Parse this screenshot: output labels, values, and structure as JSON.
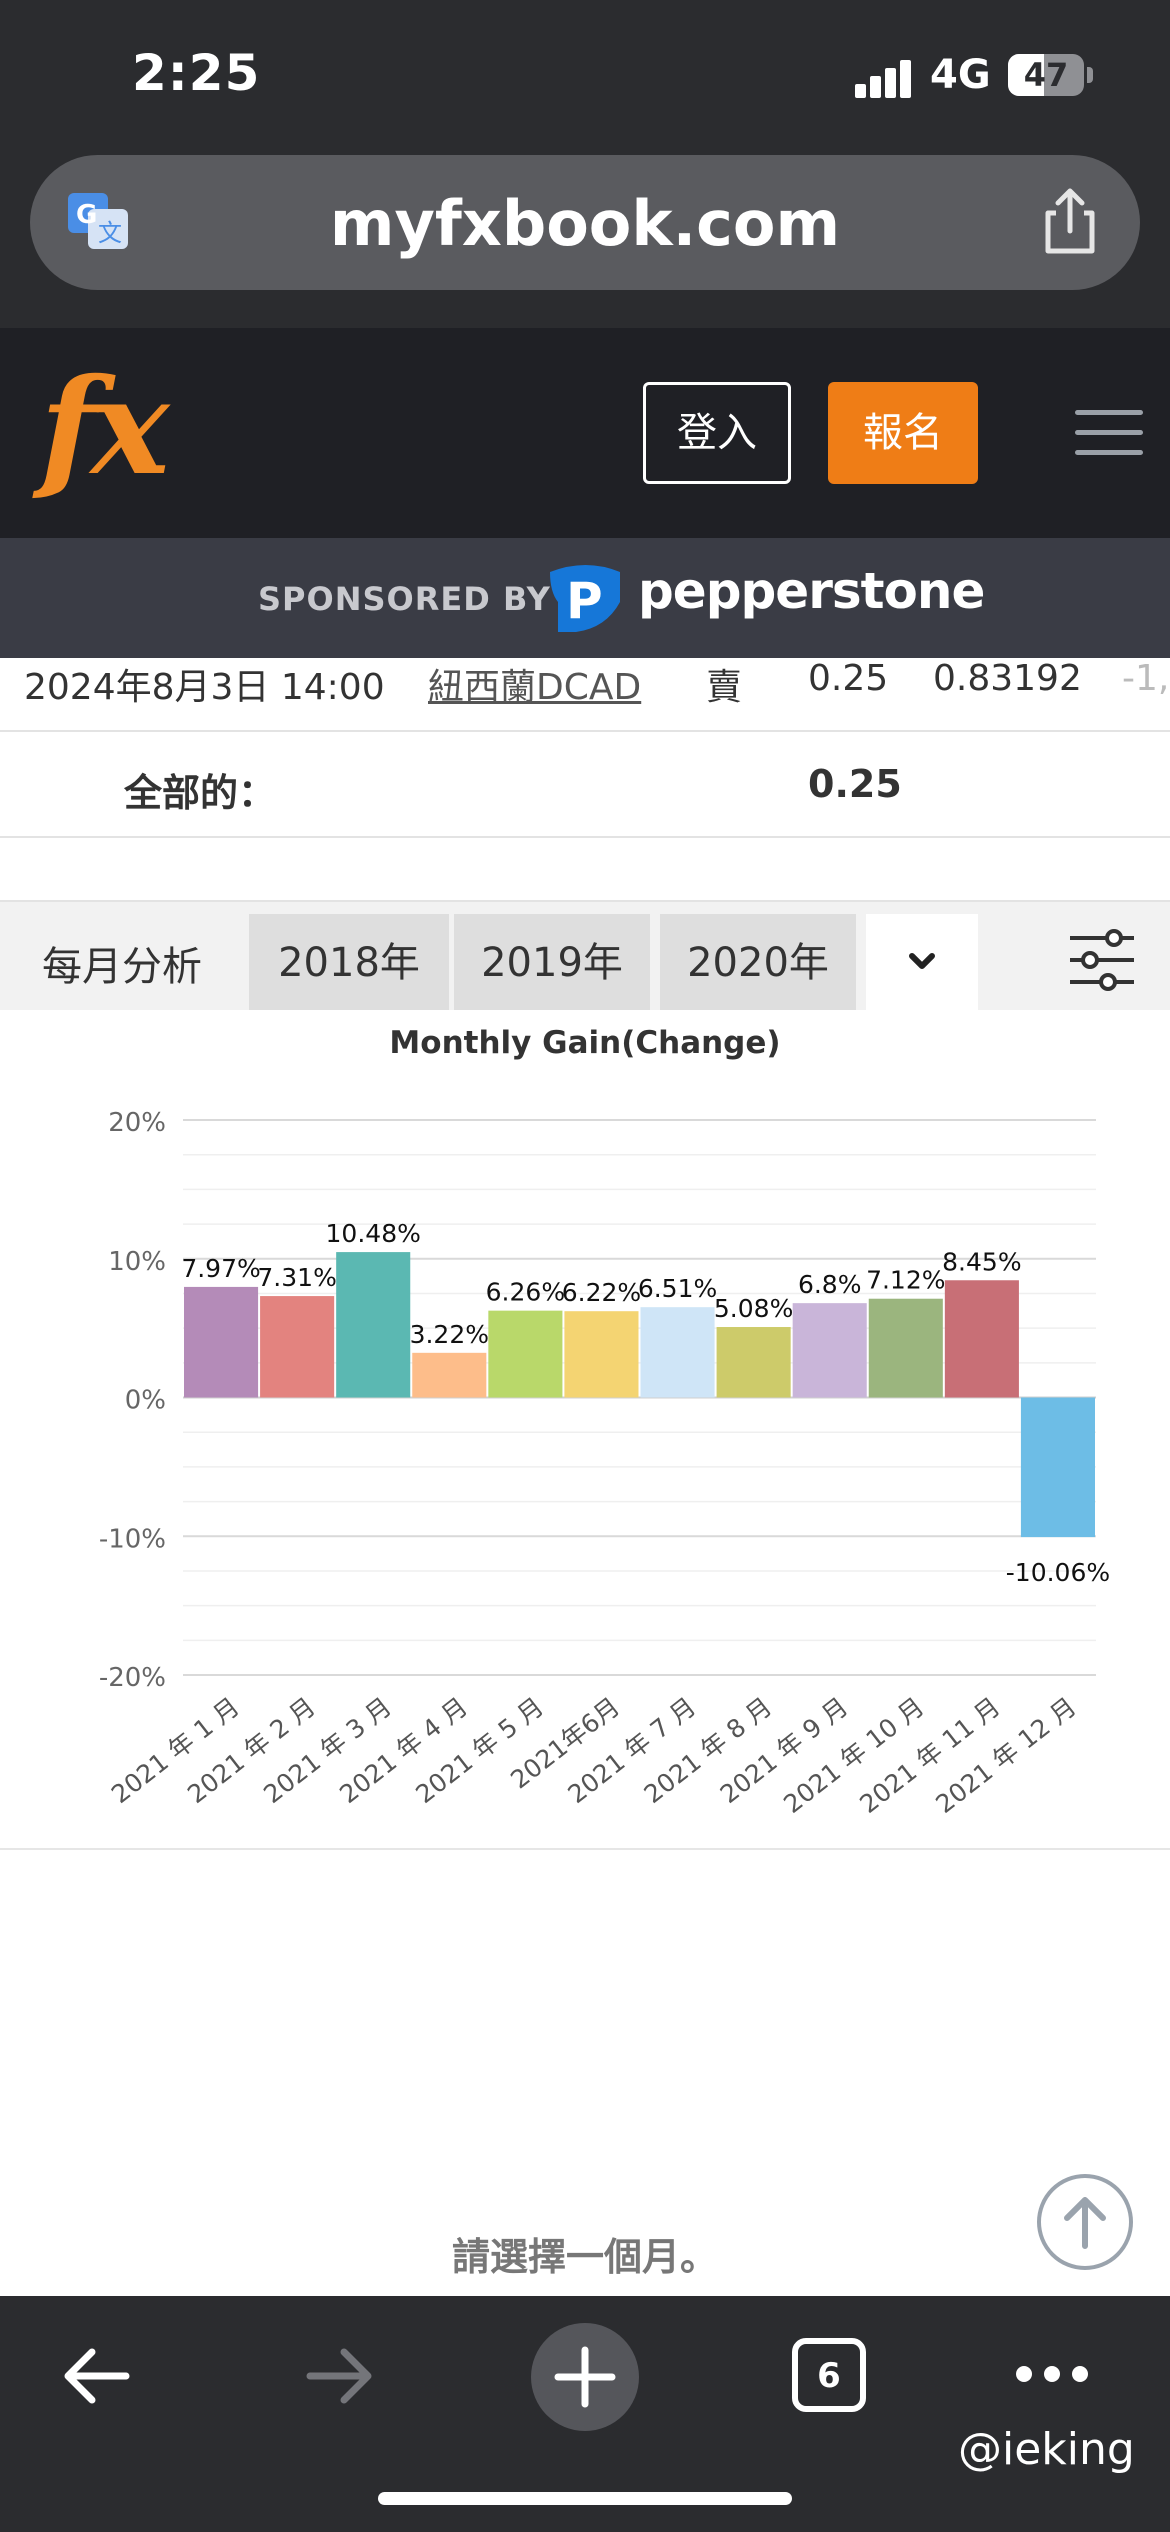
{
  "status": {
    "time": "2:25",
    "network": "4G",
    "battery": "47",
    "battery_level": 0.47
  },
  "browser": {
    "url": "myfxbook.com",
    "tab_count": "6"
  },
  "header": {
    "logo": "fx",
    "login_label": "登入",
    "signup_label": "報名"
  },
  "sponsor": {
    "label": "SPONSORED BY",
    "brand": "pepperstone"
  },
  "trade_row": {
    "date": "2024年8月3日 14:00",
    "symbol": "紐西蘭DCAD",
    "action": "賣",
    "lots": "0.25",
    "price": "0.83192",
    "extra": "-1,"
  },
  "total_row": {
    "label": "全部的：",
    "value": "0.25"
  },
  "monthly": {
    "title": "每月分析",
    "years": [
      "2018年",
      "2019年",
      "2020年"
    ]
  },
  "chart_data": {
    "type": "bar",
    "title": "Monthly Gain(Change)",
    "categories": [
      "2021 年 1 月",
      "2021 年 2 月",
      "2021 年 3 月",
      "2021 年 4 月",
      "2021 年 5 月",
      "2021年6月",
      "2021 年 7 月",
      "2021 年 8 月",
      "2021 年 9 月",
      "2021 年 10 月",
      "2021 年 11 月",
      "2021 年 12 月"
    ],
    "values": [
      7.97,
      7.31,
      10.48,
      3.22,
      6.26,
      6.22,
      6.51,
      5.08,
      6.8,
      7.12,
      8.45,
      -10.06
    ],
    "data_labels": [
      "7.97%",
      "7.31%",
      "10.48%",
      "3.22%",
      "6.26%",
      "6.22%",
      "6.51%",
      "5.08%",
      "6.8%",
      "7.12%",
      "8.45%",
      "-10.06%"
    ],
    "colors": [
      "#b48bb8",
      "#e3837f",
      "#5bb8b2",
      "#fdbd8a",
      "#b9d86a",
      "#f4d472",
      "#cfe5f7",
      "#cdcb6a",
      "#c9b5d9",
      "#9bb57e",
      "#c86f76",
      "#6dbde6"
    ],
    "yticks": [
      "20%",
      "10%",
      "0%",
      "-10%",
      "-20%"
    ],
    "ylim": [
      -20,
      20
    ],
    "grid": true
  },
  "bottom": {
    "prompt": "請選擇一個月。"
  },
  "watermark": "@ieking"
}
